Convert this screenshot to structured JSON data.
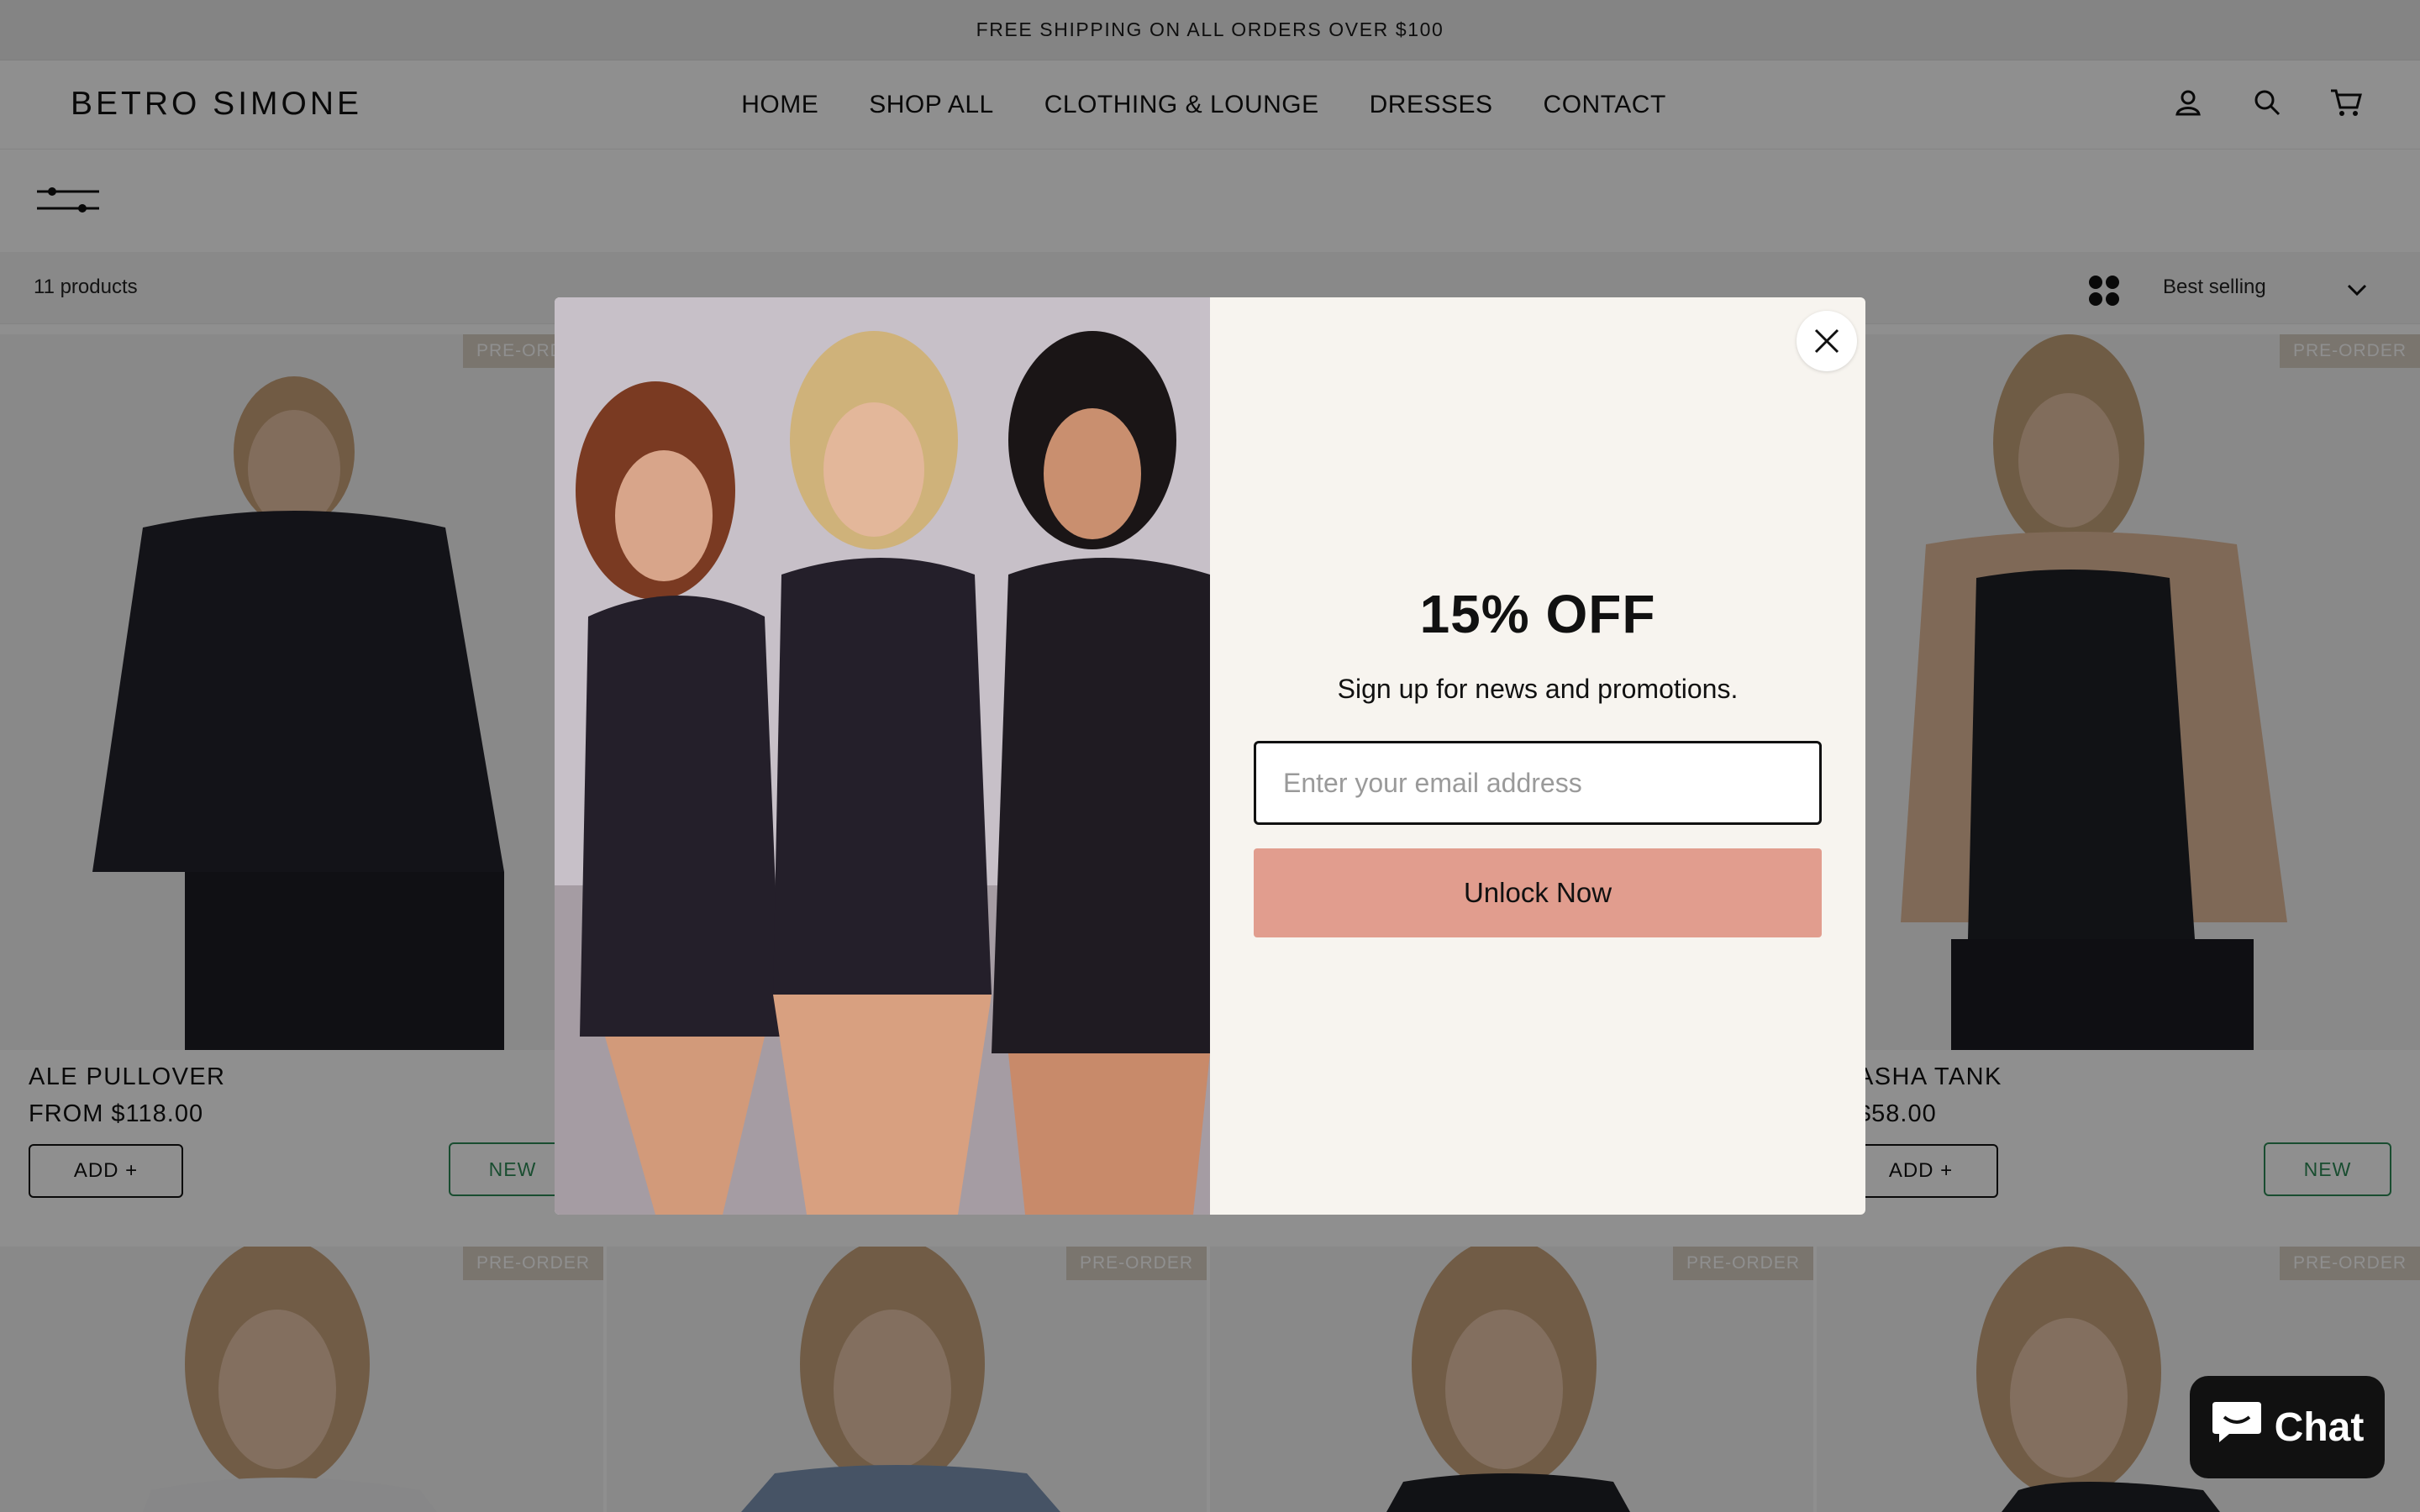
{
  "announcement": "FREE SHIPPING  ON ALL ORDERS OVER $100",
  "brand": "BETRO SIMONE",
  "nav": [
    "HOME",
    "SHOP ALL",
    "CLOTHING & LOUNGE",
    "DRESSES",
    "CONTACT"
  ],
  "header_icons": [
    "account-icon",
    "search-icon",
    "cart-icon"
  ],
  "toolbar": {
    "count": "11 products",
    "sort": "Best selling"
  },
  "products_row1": [
    {
      "name": "ALE PULLOVER",
      "price": "FROM $118.00",
      "badge": "PRE-ORDER",
      "add": "ADD  +",
      "tag": "NEW"
    },
    {
      "name": "ASHA TANK",
      "price": "$58.00",
      "badge": "PRE-ORDER",
      "add": "ADD  +",
      "tag": "NEW"
    }
  ],
  "products_row2_badges": [
    "PRE-ORDER",
    "PRE-ORDER",
    "PRE-ORDER",
    "PRE-ORDER"
  ],
  "modal": {
    "title": "15% OFF",
    "subtitle": "Sign up for news and promotions.",
    "email_placeholder": "Enter your email address",
    "button": "Unlock Now"
  },
  "chat": "Chat",
  "colors": {
    "overlay": "#000000",
    "modal_bg": "#f7f4ef",
    "cta": "#e19d8e",
    "new_tag": "#2e8a57",
    "badge": "#d9d0c5"
  }
}
